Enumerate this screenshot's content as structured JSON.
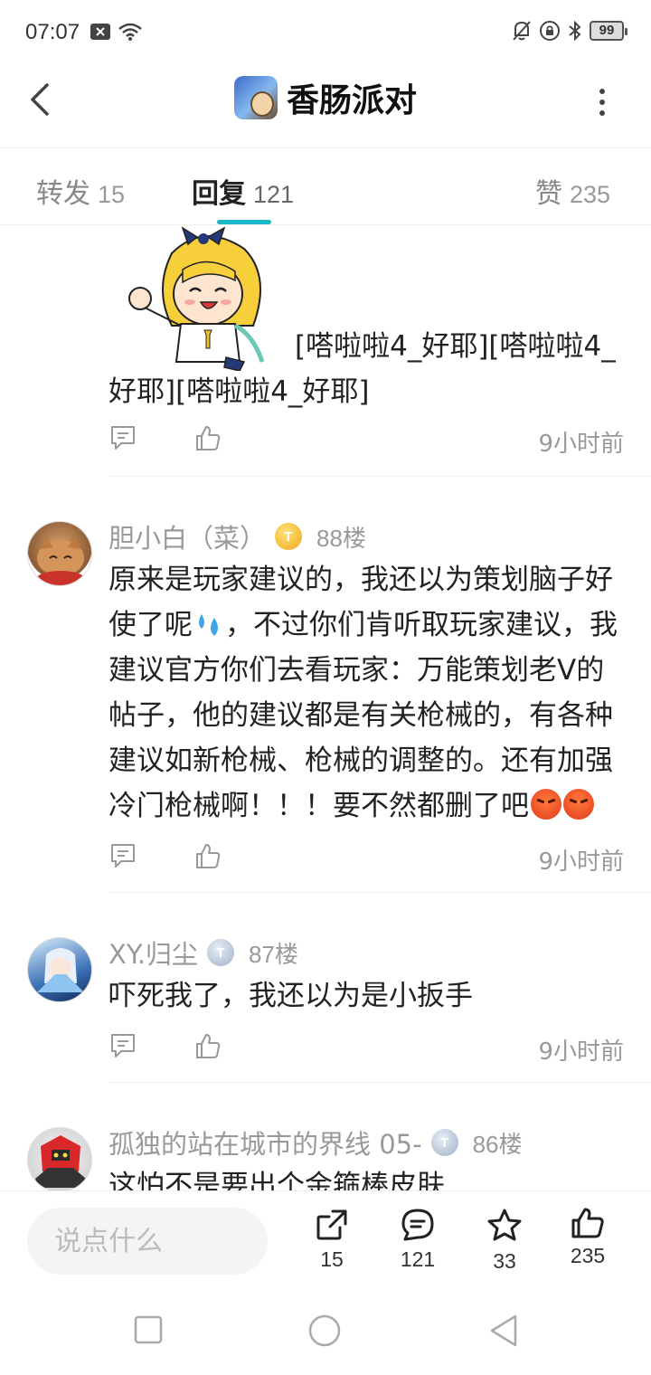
{
  "status_bar": {
    "time": "07:07",
    "battery": "99"
  },
  "header": {
    "title": "香肠派对"
  },
  "tabs": [
    {
      "label": "转发",
      "count": "15"
    },
    {
      "label": "回复",
      "count": "121"
    },
    {
      "label": "赞",
      "count": "235"
    }
  ],
  "posts": [
    {
      "text": "[嗒啦啦4_好耶][嗒啦啦4_好耶][嗒啦啦4_好耶]",
      "time": "9小时前"
    },
    {
      "username": "胆小白（菜）",
      "floor": "88楼",
      "text_a": "原来是玩家建议的，我还以为策划脑子好使了呢",
      "text_b": "，不过你们肯听取玩家建议，我建议官方你们去看玩家：万能策划老V的帖子，他的建议都是有关枪械的，有各种建议如新枪械、枪械的调整的。还有加强冷门枪械啊！！！要不然都删了吧",
      "time": "9小时前"
    },
    {
      "username": "XY.归尘",
      "floor": "87楼",
      "text": "吓死我了，我还以为是小扳手",
      "time": "9小时前"
    },
    {
      "username": "孤独的站在城市的界线 05-",
      "floor": "86楼",
      "text": "这怕不是要出个金箍棒皮肤"
    }
  ],
  "bottom_bar": {
    "input_placeholder": "说点什么",
    "share_count": "15",
    "comment_count": "121",
    "favorite_count": "33",
    "like_count": "235"
  }
}
